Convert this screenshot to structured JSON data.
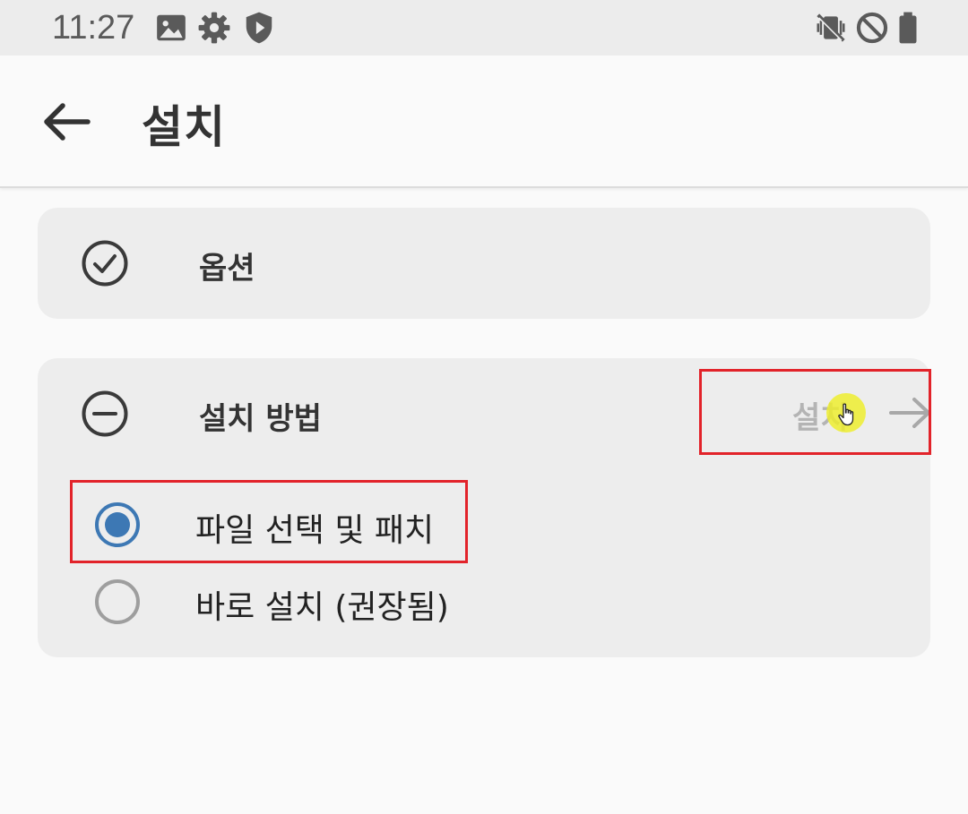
{
  "status_bar": {
    "time": "11:27",
    "left_icons": [
      "image-icon",
      "gear-icon",
      "shield-play-icon"
    ],
    "right_icons": [
      "vibrate-mute-icon",
      "do-not-disturb-icon",
      "battery-icon"
    ]
  },
  "app_bar": {
    "title": "설치",
    "back_icon": "arrow-back-icon"
  },
  "options_card": {
    "icon": "check-circle-icon",
    "label": "옵션"
  },
  "method_card": {
    "icon": "minus-circle-icon",
    "label": "설치 방법",
    "install_button": {
      "label": "설치",
      "icon": "arrow-forward-icon",
      "enabled": false
    },
    "radio_options": [
      {
        "label": "파일 선택 및 패치",
        "checked": true
      },
      {
        "label": "바로 설치 (권장됨)",
        "checked": false
      }
    ]
  },
  "colors": {
    "accent": "#3d78b4",
    "highlight": "#e2232a",
    "card": "#ededed",
    "background": "#fafafa",
    "disabled_text": "#b4b4b4"
  }
}
